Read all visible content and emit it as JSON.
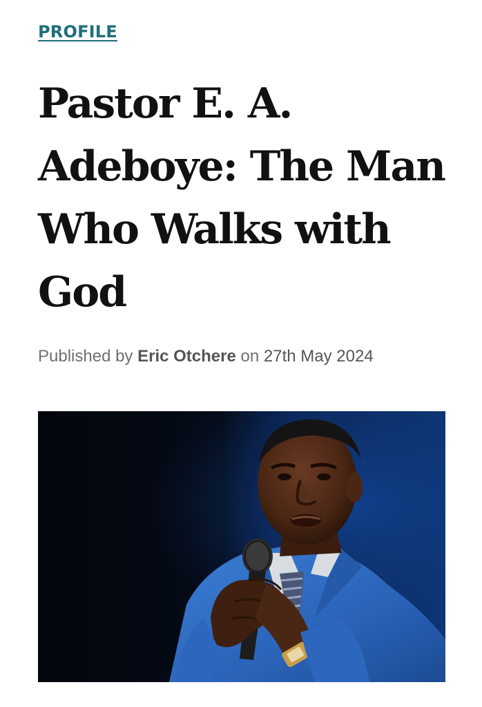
{
  "article": {
    "category": "PROFILE",
    "title": "Pastor E. A. Adeboye: The Man Who Walks with God",
    "byline": {
      "prefix": "Published by",
      "author": "Eric Otchere",
      "connector": "on",
      "date": "27th May 2024"
    },
    "hero_image": {
      "alt": "Pastor E. A. Adeboye speaking into a microphone"
    }
  },
  "colors": {
    "category_link": "#1f6f7a",
    "headline": "#111111",
    "byline_text": "#6f6f6f",
    "suit_blue": "#2f6fc4",
    "backdrop_blue": "#0c2e66"
  }
}
